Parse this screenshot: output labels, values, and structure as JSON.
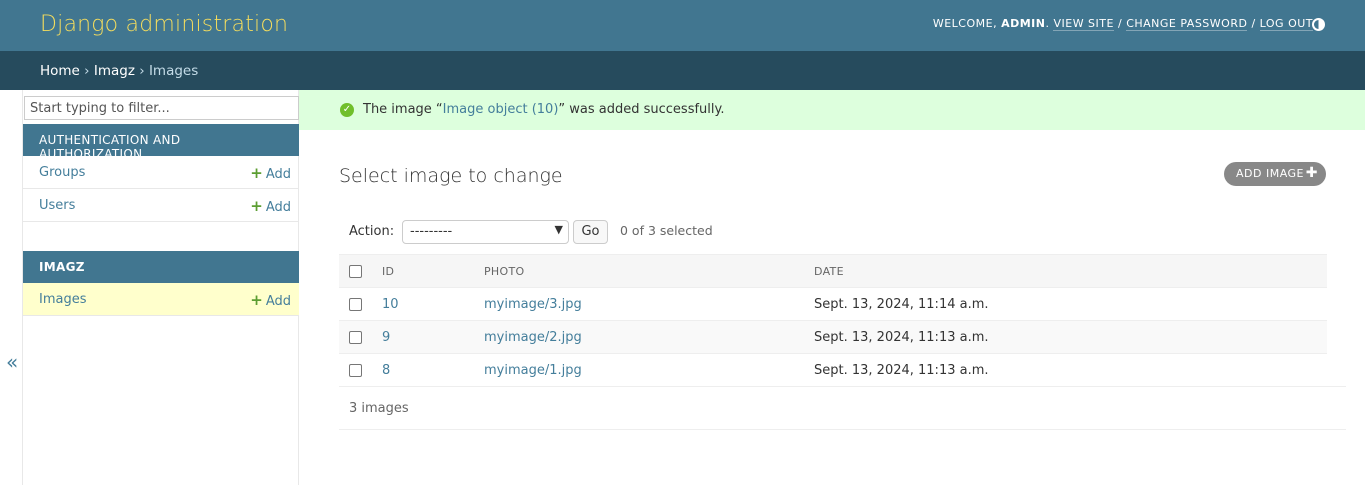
{
  "header": {
    "site_name": "Django administration",
    "welcome": "Welcome,",
    "username": "admin",
    "view_site": "View site",
    "change_password": "Change password",
    "log_out": "Log out",
    "sep": "/"
  },
  "breadcrumbs": {
    "home": "Home",
    "app": "Imagz",
    "current": "Images",
    "sep": "›"
  },
  "sidebar": {
    "filter_placeholder": "Start typing to filter...",
    "modules": [
      {
        "caption": "Authentication and Authorization",
        "rows": [
          {
            "label": "Groups",
            "add": "Add"
          },
          {
            "label": "Users",
            "add": "Add"
          }
        ]
      },
      {
        "caption": "Imagz",
        "rows": [
          {
            "label": "Images",
            "add": "Add"
          }
        ]
      }
    ],
    "toggle": "«"
  },
  "message": {
    "prefix": "The image “",
    "link": "Image object (10)",
    "suffix": "” was added successfully."
  },
  "content": {
    "title": "Select image to change",
    "add_button": "Add image",
    "action_label": "Action:",
    "action_selected": "---------",
    "go": "Go",
    "counter": "0 of 3 selected",
    "columns": [
      "ID",
      "Photo",
      "Date"
    ],
    "rows": [
      {
        "id": "10",
        "photo": "myimage/3.jpg",
        "date": "Sept. 13, 2024, 11:14 a.m."
      },
      {
        "id": "9",
        "photo": "myimage/2.jpg",
        "date": "Sept. 13, 2024, 11:13 a.m."
      },
      {
        "id": "8",
        "photo": "myimage/1.jpg",
        "date": "Sept. 13, 2024, 11:13 a.m."
      }
    ],
    "paginator": "3 images"
  },
  "colors": {
    "header": "#417690",
    "breadcrumbs": "#264b5d",
    "site_name": "#f5dd5d",
    "success_bg": "#ddffdd",
    "link": "#447e9b",
    "add_green": "#5c9e32"
  }
}
